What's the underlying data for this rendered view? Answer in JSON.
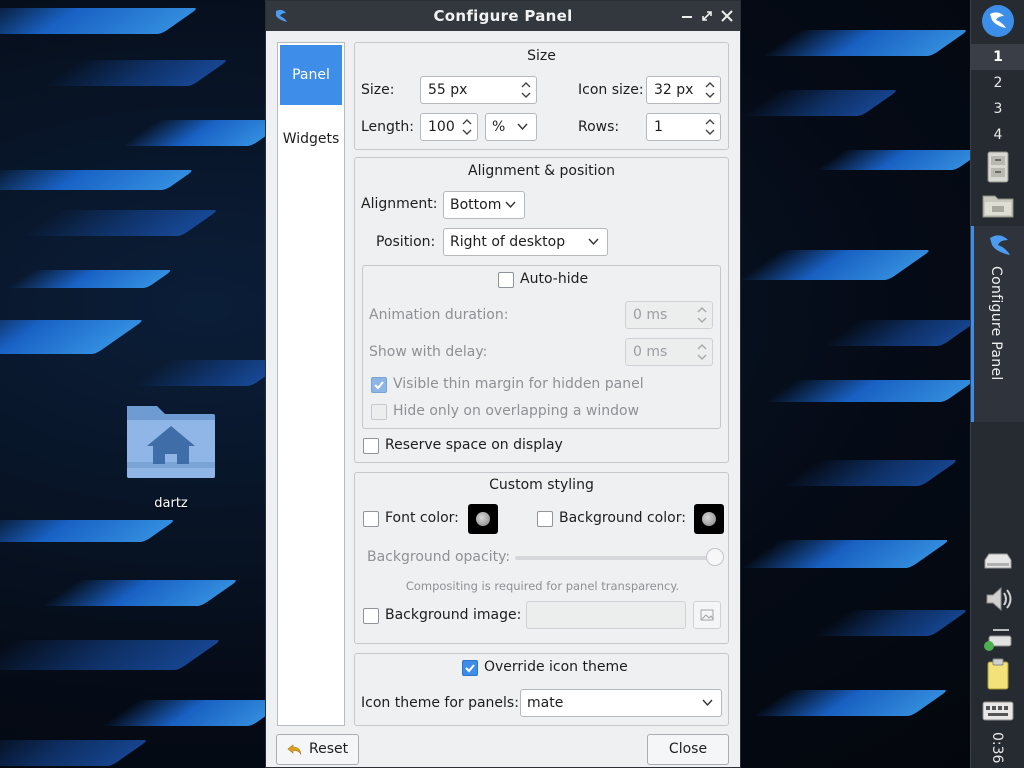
{
  "dialog": {
    "title": "Configure Panel",
    "sidebar": [
      "Panel",
      "Widgets"
    ],
    "size_group": {
      "title": "Size",
      "size_label": "Size:",
      "size_value": "55 px",
      "icon_size_label": "Icon size:",
      "icon_size_value": "32 px",
      "length_label": "Length:",
      "length_value": "100",
      "length_unit": "%",
      "rows_label": "Rows:",
      "rows_value": "1"
    },
    "alignment_group": {
      "title": "Alignment & position",
      "alignment_label": "Alignment:",
      "alignment_value": "Bottom",
      "position_label": "Position:",
      "position_value": "Right of desktop",
      "autohide": {
        "label": "Auto-hide",
        "checked": false,
        "animation_label": "Animation duration:",
        "animation_value": "0 ms",
        "delay_label": "Show with delay:",
        "delay_value": "0 ms",
        "thin_margin_label": "Visible thin margin for hidden panel",
        "thin_margin_checked": true,
        "hide_overlap_label": "Hide only on overlapping a window",
        "hide_overlap_checked": false
      },
      "reserve_label": "Reserve space on display",
      "reserve_checked": false
    },
    "styling_group": {
      "title": "Custom styling",
      "font_color_label": "Font color:",
      "bg_color_label": "Background color:",
      "opacity_label": "Background opacity:",
      "opacity_value": 1.0,
      "compositing_note": "Compositing is required for panel transparency.",
      "bg_image_label": "Background image:"
    },
    "icon_theme_group": {
      "override_label": "Override icon theme",
      "override_checked": true,
      "theme_label": "Icon theme for panels:",
      "theme_value": "mate"
    },
    "reset_label": "Reset",
    "close_label": "Close"
  },
  "desktop": {
    "icon_label": "dartz"
  },
  "side_panel": {
    "workspaces": [
      "1",
      "2",
      "3",
      "4"
    ],
    "active_workspace": "1",
    "task_label": "Configure Panel",
    "clock": "0:36"
  },
  "colors": {
    "accent": "#3e8de8",
    "titlebar": "#33383f",
    "panel_bg": "#262a31"
  }
}
